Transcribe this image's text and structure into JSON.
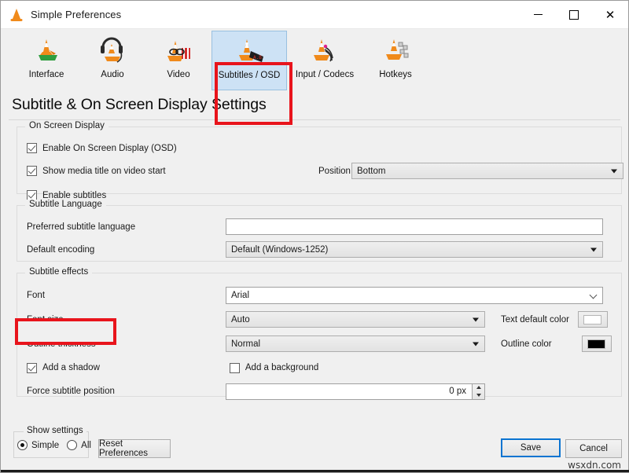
{
  "window": {
    "title": "Simple Preferences",
    "icon": "vlc-cone-icon",
    "controls": {
      "minimize": "minimize-icon",
      "maximize": "maximize-icon",
      "close": "close-icon"
    }
  },
  "toolbar": {
    "items": [
      {
        "label": "Interface",
        "icon": "vlc-cone-icon",
        "selected": false
      },
      {
        "label": "Audio",
        "icon": "vlc-cone-headphones-icon",
        "selected": false
      },
      {
        "label": "Video",
        "icon": "vlc-cone-video-icon",
        "selected": false
      },
      {
        "label": "Subtitles / OSD",
        "icon": "vlc-cone-subtitles-icon",
        "selected": true
      },
      {
        "label": "Input / Codecs",
        "icon": "vlc-cone-input-icon",
        "selected": false
      },
      {
        "label": "Hotkeys",
        "icon": "vlc-cone-hotkeys-icon",
        "selected": false
      }
    ]
  },
  "page": {
    "heading": "Subtitle & On Screen Display Settings"
  },
  "osd_group": {
    "legend": "On Screen Display",
    "enable_osd": {
      "label": "Enable On Screen Display (OSD)",
      "checked": true
    },
    "show_media_title": {
      "label": "Show media title on video start",
      "checked": true
    },
    "position": {
      "label": "Position",
      "value": "Bottom"
    },
    "enable_subtitles": {
      "label": "Enable subtitles",
      "checked": true
    }
  },
  "language_group": {
    "legend": "Subtitle Language",
    "preferred_language": {
      "label": "Preferred subtitle language",
      "value": "",
      "placeholder": ""
    },
    "default_encoding": {
      "label": "Default encoding",
      "value": "Default (Windows-1252)"
    }
  },
  "effects_group": {
    "legend": "Subtitle effects",
    "font": {
      "label": "Font",
      "value": "Arial"
    },
    "font_size": {
      "label": "Font size",
      "value": "Auto"
    },
    "outline_thickness": {
      "label": "Outline thickness",
      "value": "Normal"
    },
    "text_default_color": {
      "label": "Text default color",
      "color": "#ffffff"
    },
    "outline_color": {
      "label": "Outline color",
      "color": "#000000"
    },
    "add_shadow": {
      "label": "Add a shadow",
      "checked": true
    },
    "add_background": {
      "label": "Add a background",
      "checked": false
    },
    "force_position": {
      "label": "Force subtitle position",
      "value": "0 px"
    }
  },
  "footer": {
    "show_settings": {
      "legend": "Show settings",
      "simple": {
        "label": "Simple",
        "selected": true
      },
      "all": {
        "label": "All",
        "selected": false
      }
    },
    "reset_label": "Reset Preferences",
    "save_label": "Save",
    "cancel_label": "Cancel"
  },
  "watermark": "wsxdn.com",
  "colors": {
    "accent_blue": "#0a74d1",
    "annotation_red": "#e8141c",
    "selected_tab_bg": "#cde2f5"
  }
}
